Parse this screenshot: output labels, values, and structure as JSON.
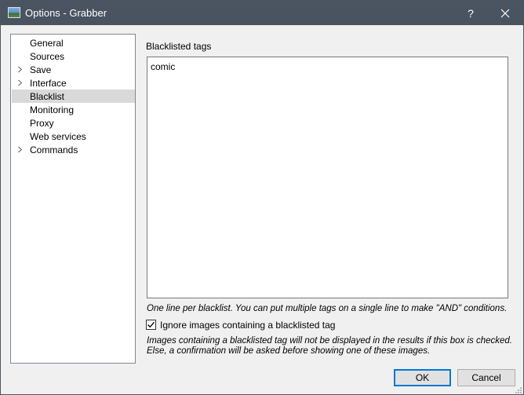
{
  "window": {
    "title": "Options - Grabber",
    "help_label": "?",
    "icons": {
      "app": "app-icon",
      "close": "close-icon",
      "help": "help-icon"
    }
  },
  "nav": {
    "items": [
      {
        "label": "General",
        "expandable": false,
        "selected": false
      },
      {
        "label": "Sources",
        "expandable": false,
        "selected": false
      },
      {
        "label": "Save",
        "expandable": true,
        "selected": false
      },
      {
        "label": "Interface",
        "expandable": true,
        "selected": false
      },
      {
        "label": "Blacklist",
        "expandable": false,
        "selected": true
      },
      {
        "label": "Monitoring",
        "expandable": false,
        "selected": false
      },
      {
        "label": "Proxy",
        "expandable": false,
        "selected": false
      },
      {
        "label": "Web services",
        "expandable": false,
        "selected": false
      },
      {
        "label": "Commands",
        "expandable": true,
        "selected": false
      }
    ]
  },
  "blacklist": {
    "label": "Blacklisted tags",
    "value": "comic",
    "hint": "One line per blacklist. You can put multiple tags on a single line to make \"AND\" conditions.",
    "checkbox": {
      "label": "Ignore images containing a blacklisted tag",
      "checked": true
    },
    "note_line1": "Images containing a blacklisted tag will not be displayed in the results if this box is checked.",
    "note_line2": "Else, a confirmation will be asked before showing one of these images."
  },
  "buttons": {
    "ok": "OK",
    "cancel": "Cancel"
  },
  "colors": {
    "titlebar": "#4a5360",
    "selection": "#d9d9d9",
    "default_button_border": "#0078d7"
  }
}
